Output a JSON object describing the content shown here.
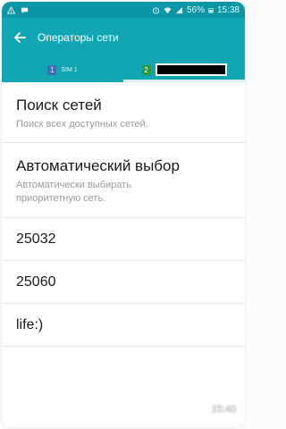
{
  "status_bar": {
    "battery": "56%",
    "time": "15:38",
    "icons": [
      "warning-icon",
      "chat-icon",
      "alarm-icon",
      "wifi-icon",
      "signal-icon",
      "battery-icon"
    ]
  },
  "app_bar": {
    "title": "Операторы сети",
    "back_icon": "arrow-left-icon"
  },
  "tabs": [
    {
      "badge": "1",
      "label": "SIM 1",
      "selected": false
    },
    {
      "badge": "2",
      "label": "",
      "selected": true
    }
  ],
  "list": {
    "search": {
      "title": "Поиск сетей",
      "subtitle": "Поиск всех доступных сетей."
    },
    "auto": {
      "title": "Автоматический выбор",
      "subtitle": "Автоматически выбирать приоритетную сеть."
    },
    "operators": [
      "25032",
      "25060",
      "life:)"
    ]
  },
  "overlay_time": "15:40",
  "colors": {
    "status_bar": "#0b96a6",
    "app_bar": "#12a5b4",
    "sim1_badge": "#3a6fb8",
    "sim2_badge": "#2d9a3a"
  }
}
